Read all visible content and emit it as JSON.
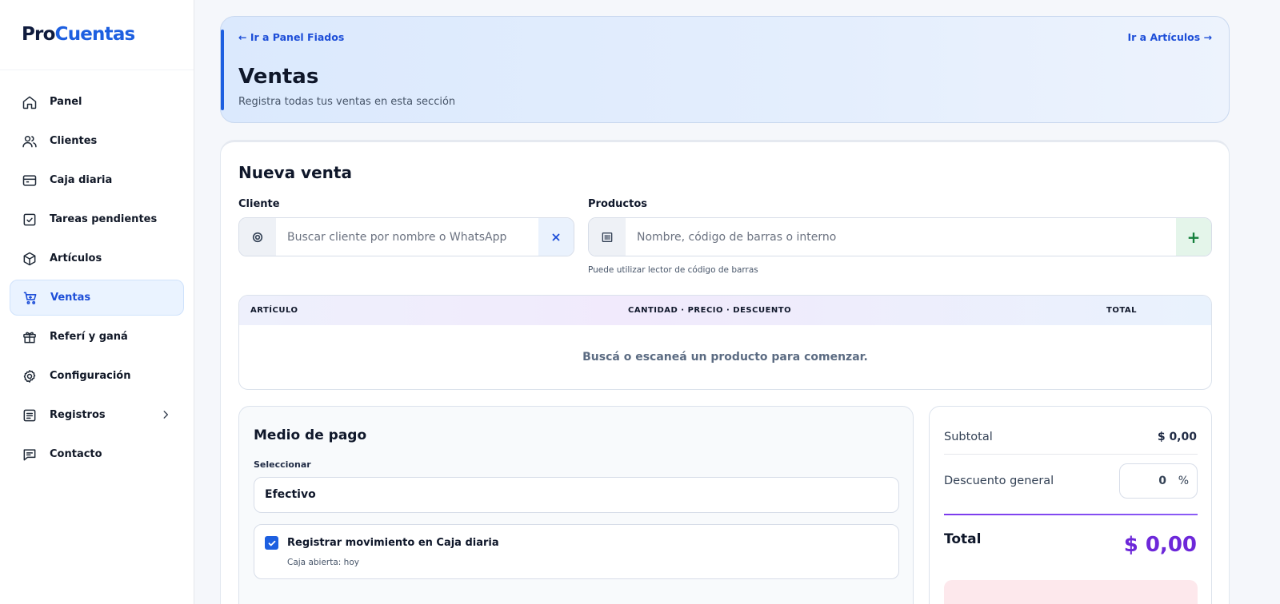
{
  "brand": {
    "part1": "Pro",
    "part2": "Cuentas"
  },
  "sidebar": {
    "items": [
      {
        "label": "Panel",
        "icon": "home-icon"
      },
      {
        "label": "Clientes",
        "icon": "users-icon"
      },
      {
        "label": "Caja diaria",
        "icon": "cash-register-icon"
      },
      {
        "label": "Tareas pendientes",
        "icon": "checklist-icon"
      },
      {
        "label": "Artículos",
        "icon": "box-icon"
      },
      {
        "label": "Ventas",
        "icon": "cart-icon",
        "active": true
      },
      {
        "label": "Referí y ganá",
        "icon": "gift-icon"
      },
      {
        "label": "Configuración",
        "icon": "gear-icon"
      },
      {
        "label": "Registros",
        "icon": "document-list-icon",
        "has_submenu": true
      },
      {
        "label": "Contacto",
        "icon": "chat-icon"
      }
    ]
  },
  "header": {
    "back_link": "← Ir a Panel Fiados",
    "forward_link": "Ir a Artículos →",
    "title": "Ventas",
    "subtitle": "Registra todas tus ventas en esta sección"
  },
  "new_sale": {
    "title": "Nueva venta",
    "client": {
      "label": "Cliente",
      "placeholder": "Buscar cliente por nombre o WhatsApp",
      "value": ""
    },
    "products": {
      "label": "Productos",
      "placeholder": "Nombre, código de barras o interno",
      "value": "",
      "hint": "Puede utilizar lector de código de barras",
      "add_label": "+"
    },
    "table": {
      "columns": [
        "ARTÍCULO",
        "CANTIDAD · PRECIO · DESCUENTO",
        "TOTAL"
      ],
      "empty_message": "Buscá o escaneá un producto para comenzar."
    },
    "payment": {
      "title": "Medio de pago",
      "select_label": "Seleccionar",
      "selected": "Efectivo",
      "register_label": "Registrar movimiento en Caja diaria",
      "register_checked": true,
      "caja_status": "Caja abierta: hoy"
    },
    "summary": {
      "subtotal_label": "Subtotal",
      "subtotal_value": "$ 0,00",
      "discount_label": "Descuento general",
      "discount_value": "0",
      "discount_unit": "%",
      "total_label": "Total",
      "total_value": "$ 0,00"
    }
  },
  "colors": {
    "brand_blue": "#1d5fe0",
    "total_purple": "#6d28d9",
    "active_nav_bg": "#eaf3ff",
    "add_green": "#15803d"
  }
}
